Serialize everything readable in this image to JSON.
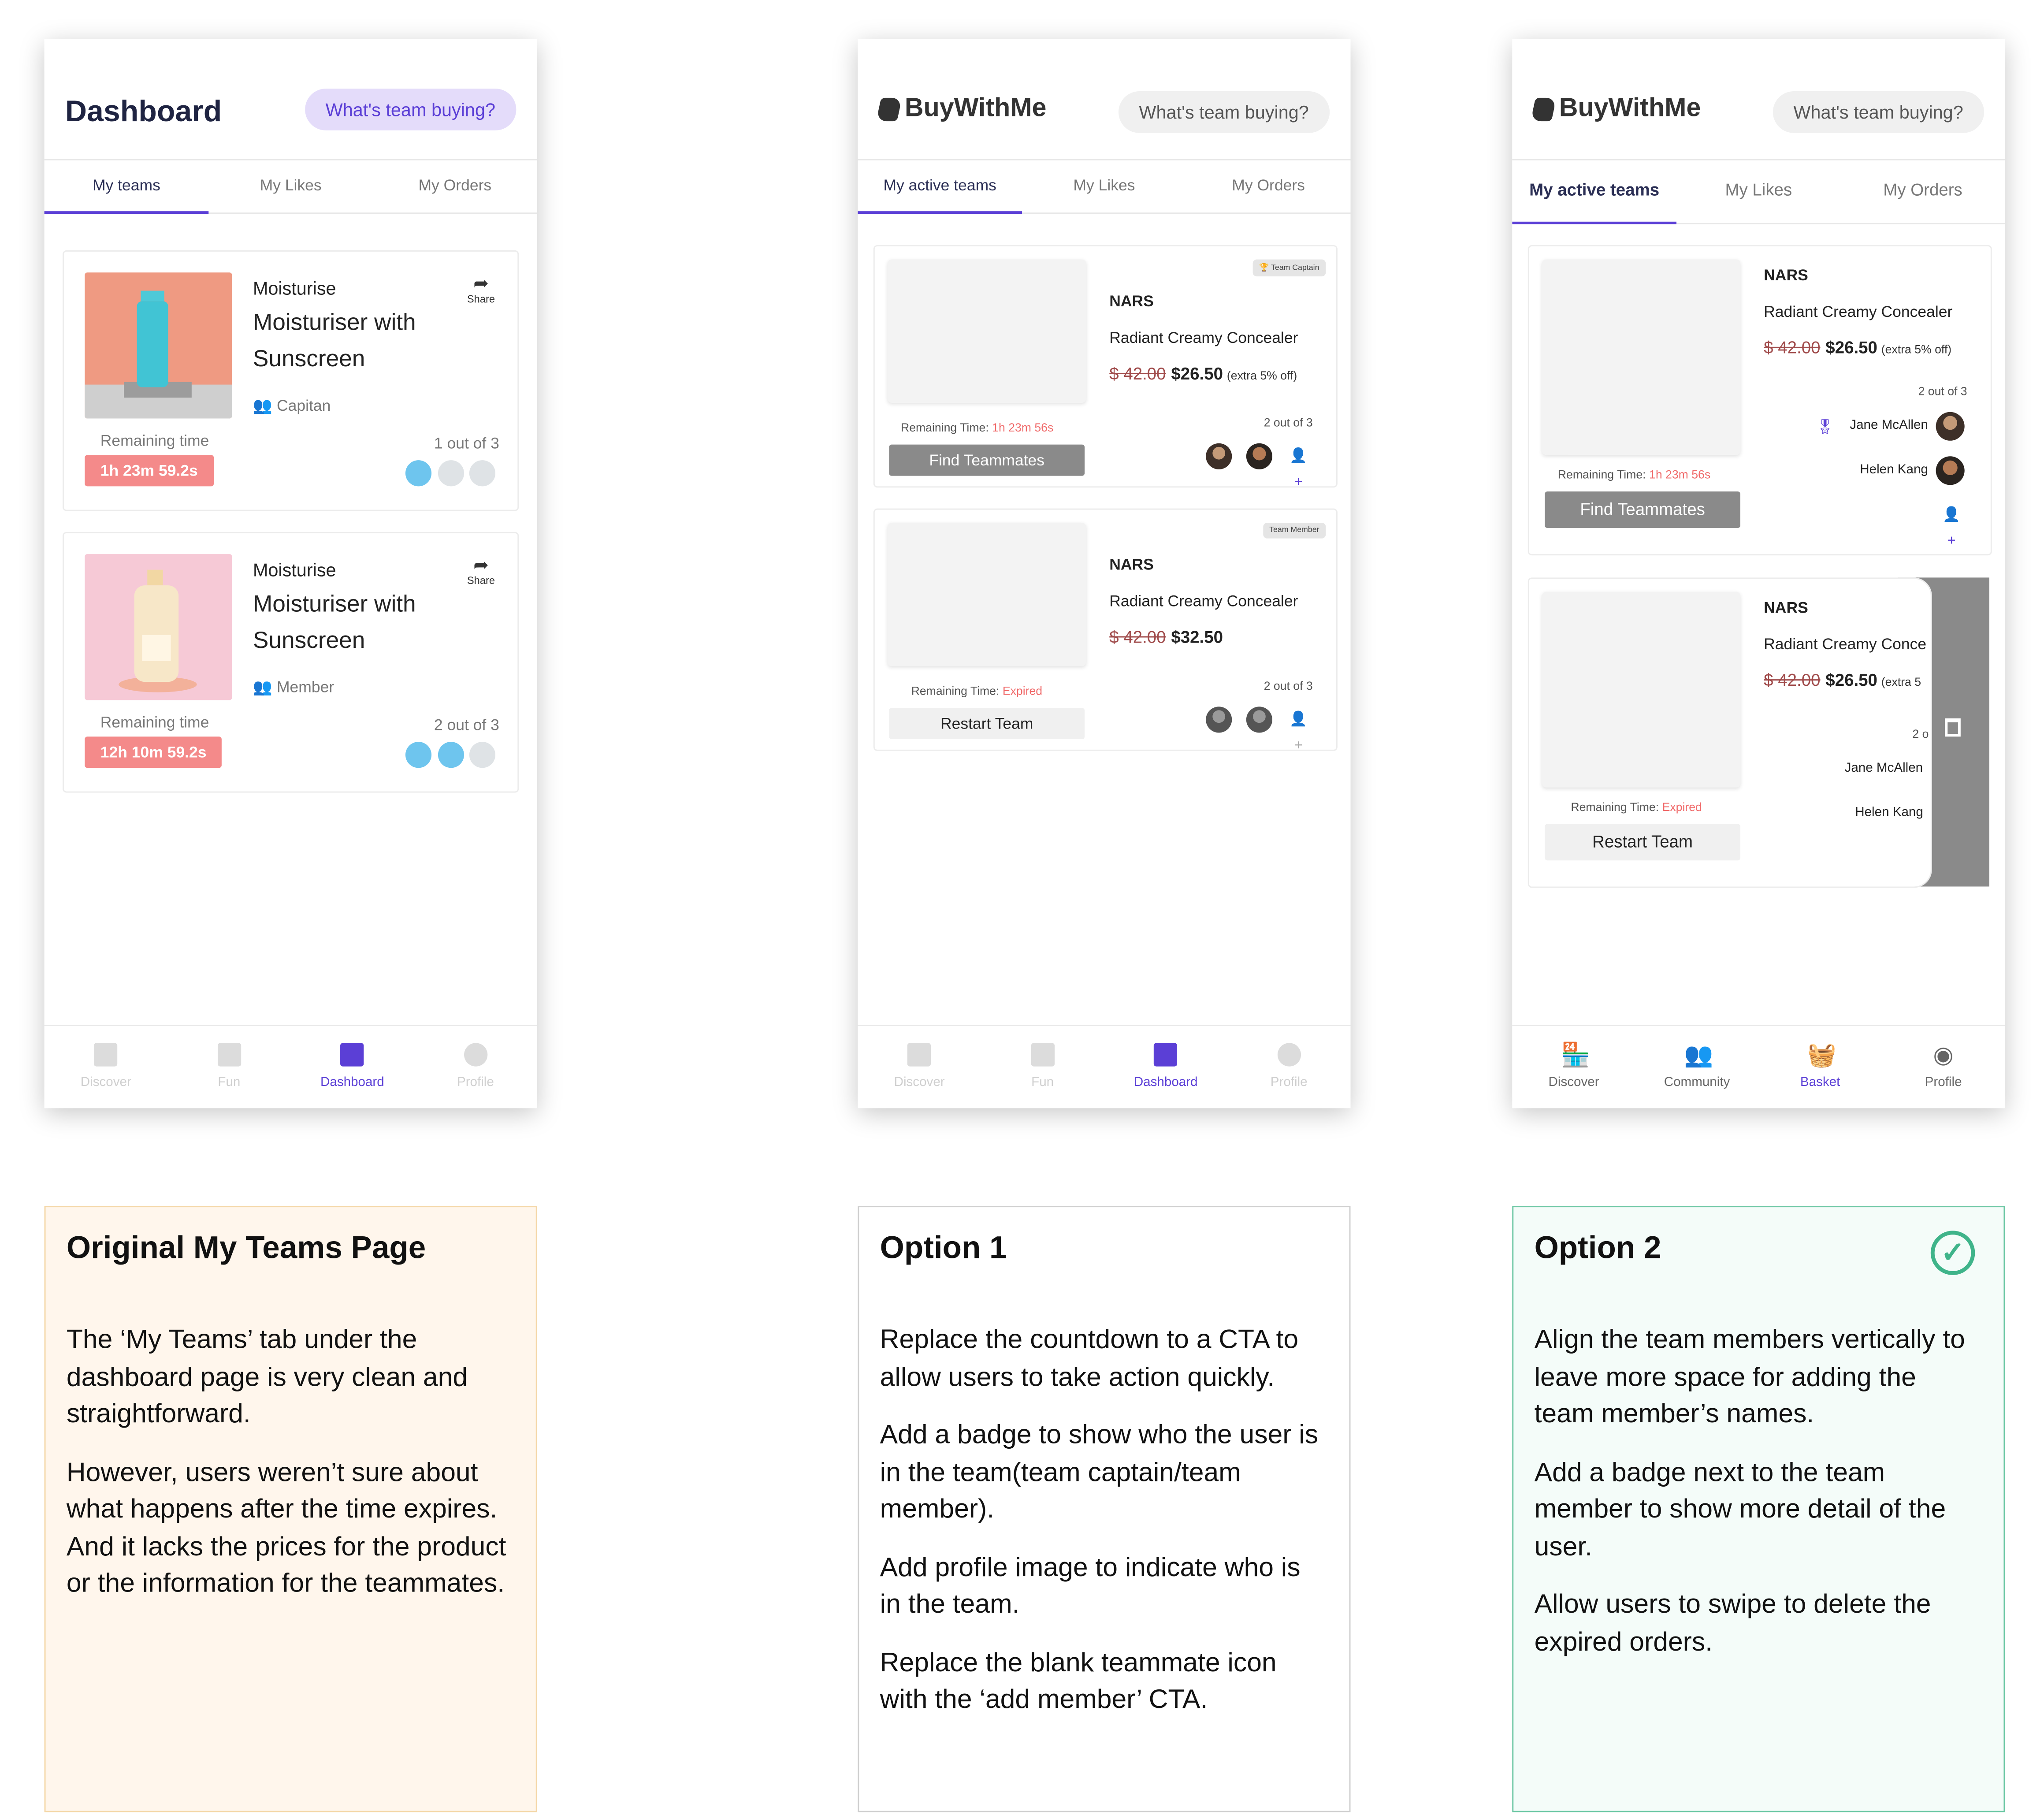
{
  "colors": {
    "accent": "#5b3fd6",
    "timer": "#f48a8a",
    "expired": "#f06a6a",
    "approved": "#3fb48a"
  },
  "screens": {
    "original": {
      "title": "Dashboard",
      "search_placeholder": "What's team buying?",
      "tabs": [
        "My teams",
        "My Likes",
        "My Orders"
      ],
      "cards": [
        {
          "category": "Moisturise",
          "name_line1": "Moisturiser with",
          "name_line2": "Sunscreen",
          "share": "Share",
          "role": "Capitan",
          "remaining_label": "Remaining time",
          "timer": "1h 23m 59.2s",
          "count": "1 out of 3"
        },
        {
          "category": "Moisturise",
          "name_line1": "Moisturiser with",
          "name_line2": "Sunscreen",
          "share": "Share",
          "role": "Member",
          "remaining_label": "Remaining time",
          "timer": "12h 10m 59.2s",
          "count": "2 out of 3"
        }
      ],
      "nav": [
        "Discover",
        "Fun",
        "Dashboard",
        "Profile"
      ]
    },
    "option1": {
      "logo": "BuyWithMe",
      "search_placeholder": "What's team buying?",
      "tabs": [
        "My active teams",
        "My Likes",
        "My Orders"
      ],
      "cards": [
        {
          "badge": "Team Captain",
          "brand": "NARS",
          "product": "Radiant Creamy Concealer",
          "old_price": "$ 42.00",
          "new_price": "$26.50",
          "extra": "(extra 5% off)",
          "remaining_label": "Remaining Time:",
          "remaining_value": "1h 23m 56s",
          "count": "2 out of 3",
          "button": "Find Teammates"
        },
        {
          "badge": "Team Member",
          "brand": "NARS",
          "product": "Radiant Creamy Concealer",
          "old_price": "$ 42.00",
          "new_price": "$32.50",
          "remaining_label": "Remaining Time:",
          "remaining_value": "Expired",
          "count": "2 out of 3",
          "button": "Restart Team"
        }
      ],
      "nav": [
        "Discover",
        "Fun",
        "Dashboard",
        "Profile"
      ]
    },
    "option2": {
      "logo": "BuyWithMe",
      "search_placeholder": "What's team buying?",
      "tabs": [
        "My active teams",
        "My Likes",
        "My Orders"
      ],
      "cards": [
        {
          "brand": "NARS",
          "product": "Radiant Creamy Concealer",
          "old_price": "$ 42.00",
          "new_price": "$26.50",
          "extra": "(extra 5% off)",
          "count": "2 out of 3",
          "member1": "Jane McAllen",
          "member2": "Helen Kang",
          "remaining_label": "Remaining Time:",
          "remaining_value": "1h 23m 56s",
          "button": "Find Teammates"
        },
        {
          "brand": "NARS",
          "product": "Radiant Creamy Conce",
          "old_price": "$ 42.00",
          "new_price": "$26.50",
          "extra": "(extra 5",
          "count": "2 o",
          "member1": "Jane McAllen",
          "member2": "Helen Kang",
          "remaining_label": "Remaining Time:",
          "remaining_value": "Expired",
          "button": "Restart Team"
        }
      ],
      "nav": [
        "Discover",
        "Community",
        "Basket",
        "Profile"
      ]
    }
  },
  "notes": {
    "original": {
      "title": "Original My Teams Page",
      "paragraphs": [
        "The ‘My Teams’ tab under the dashboard page is very clean and straightforward.",
        "However, users weren’t sure about what happens after the time expires. And it lacks the prices for the product or the information for the teammates."
      ]
    },
    "option1": {
      "title": "Option 1",
      "paragraphs": [
        "Replace the countdown to a CTA to allow users to take action quickly.",
        "Add a badge to show who the user is in the team(team captain/team member).",
        "Add profile image to indicate who is in the team.",
        "Replace the blank teammate icon with the ‘add member’ CTA."
      ]
    },
    "option2": {
      "title": "Option 2",
      "paragraphs": [
        "Align the team members vertically to leave more space for adding the team member’s names.",
        "Add a badge next to the team member to show more detail of the user.",
        "Allow users to swipe to delete the expired orders."
      ]
    }
  }
}
